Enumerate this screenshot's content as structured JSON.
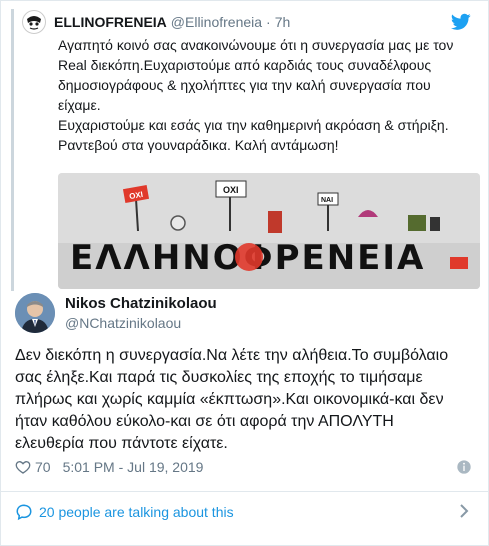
{
  "quoted_tweet": {
    "author_name": "ELLINOFRENEIA",
    "author_handle": "@Ellinofreneia",
    "dot": "·",
    "time": "7h",
    "text_lines": [
      "Αγαπητό κοινό σας ανακοινώνουμε ότι η συνεργασία μας με τον",
      "Real διεκόπη.Ευχαριστούμε από καρδιάς τους συναδέλφους",
      "δημοσιογράφους & ηχολήπτες για την καλή συνεργασία που",
      "είχαμε.",
      "Ευχαριστούμε και εσάς για την καθημερινή ακρόαση & στήριξη.",
      "Ραντεβού στα γουναράδικα. Καλή αντάμωση!"
    ],
    "image": {
      "logo_text": "ΕΛΛΗΝΟΦΡΕΝΕΙΑ",
      "sign_left": "ΟΧΙ",
      "sign_center": "ΟΧΙ",
      "sign_right": "ΝΑΙ"
    }
  },
  "tweet": {
    "author_name": "Nikos Chatzinikolaou",
    "author_handle": "@NChatzinikolaou",
    "text_lines": [
      "Δεν διεκόπη η συνεργασία.Να λέτε την αλήθεια.Το συμβόλαιο",
      "σας έληξε.Και παρά τις δυσκολίες της εποχής το τιμήσαμε",
      "πλήρως και χωρίς καμμία «έκπτωση».Και οικονομικά-και δεν",
      "ήταν καθόλου εύκολο-και σε ότι αφορά την ΑΠΟΛΥΤΗ",
      "ελευθερία που πάντοτε είχατε."
    ],
    "likes": "70",
    "timestamp": "5:01 PM - Jul 19, 2019",
    "talking": "20 people are talking about this"
  },
  "colors": {
    "twitter_blue": "#1da1f2",
    "link_blue": "#1b95e0",
    "secondary_text": "#657786",
    "logo_red": "#e0392b"
  },
  "icons": {
    "bird": "twitter-bird-icon",
    "heart": "heart-icon",
    "info": "info-icon",
    "comment": "comment-icon",
    "chevron": "chevron-right-icon"
  }
}
